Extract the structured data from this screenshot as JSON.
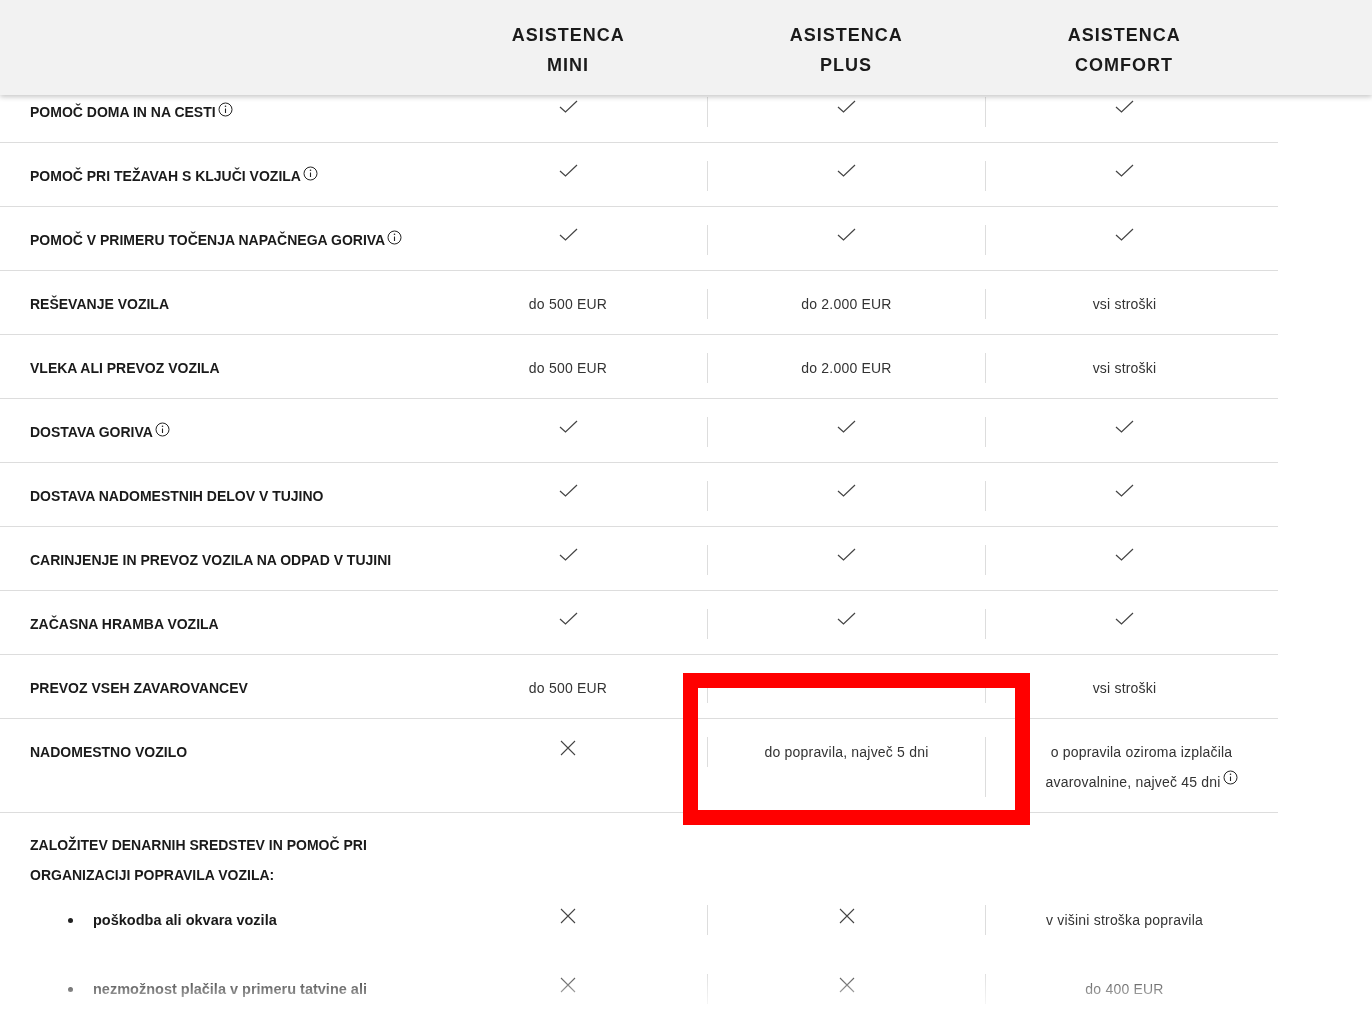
{
  "columns": [
    "ASISTENCA MINI",
    "ASISTENCA PLUS",
    "ASISTENCA COMFORT"
  ],
  "rows": [
    {
      "kind": "feature",
      "label": "POMOČ DOMA IN NA CESTI",
      "info": true,
      "cells": [
        {
          "kind": "check"
        },
        {
          "kind": "check"
        },
        {
          "kind": "check"
        }
      ]
    },
    {
      "kind": "feature",
      "label": "POMOČ PRI TEŽAVAH S KLJUČI VOZILA",
      "info": true,
      "cells": [
        {
          "kind": "check"
        },
        {
          "kind": "check"
        },
        {
          "kind": "check"
        }
      ]
    },
    {
      "kind": "feature",
      "label": "POMOČ V PRIMERU TOČENJA NAPAČNEGA GORIVA",
      "info": true,
      "cells": [
        {
          "kind": "check"
        },
        {
          "kind": "check"
        },
        {
          "kind": "check"
        }
      ]
    },
    {
      "kind": "feature",
      "label": "REŠEVANJE VOZILA",
      "info": false,
      "cells": [
        {
          "kind": "text",
          "lines": [
            "do 500 EUR"
          ]
        },
        {
          "kind": "text",
          "lines": [
            "do 2.000 EUR"
          ]
        },
        {
          "kind": "text",
          "lines": [
            "vsi stroški"
          ]
        }
      ]
    },
    {
      "kind": "feature",
      "label": "VLEKA ALI PREVOZ VOZILA",
      "info": false,
      "cells": [
        {
          "kind": "text",
          "lines": [
            "do 500 EUR"
          ]
        },
        {
          "kind": "text",
          "lines": [
            "do 2.000 EUR"
          ]
        },
        {
          "kind": "text",
          "lines": [
            "vsi stroški"
          ]
        }
      ]
    },
    {
      "kind": "feature",
      "label": "DOSTAVA GORIVA",
      "info": true,
      "cells": [
        {
          "kind": "check"
        },
        {
          "kind": "check"
        },
        {
          "kind": "check"
        }
      ]
    },
    {
      "kind": "feature",
      "label": "DOSTAVA NADOMESTNIH DELOV V TUJINO",
      "info": false,
      "cells": [
        {
          "kind": "check"
        },
        {
          "kind": "check"
        },
        {
          "kind": "check"
        }
      ]
    },
    {
      "kind": "feature",
      "label": "CARINJENJE IN PREVOZ VOZILA NA ODPAD V TUJINI",
      "info": false,
      "cells": [
        {
          "kind": "check"
        },
        {
          "kind": "check"
        },
        {
          "kind": "check"
        }
      ]
    },
    {
      "kind": "feature",
      "label": "ZAČASNA HRAMBA VOZILA",
      "info": false,
      "cells": [
        {
          "kind": "check"
        },
        {
          "kind": "check"
        },
        {
          "kind": "check"
        }
      ]
    },
    {
      "kind": "feature",
      "label": "PREVOZ VSEH ZAVAROVANCEV",
      "info": false,
      "cells": [
        {
          "kind": "text",
          "lines": [
            "do 500 EUR"
          ]
        },
        {
          "kind": "blank"
        },
        {
          "kind": "text",
          "lines": [
            "vsi stroški"
          ]
        }
      ]
    },
    {
      "kind": "feature",
      "label": "NADOMESTNO VOZILO",
      "info": false,
      "cells": [
        {
          "kind": "cross"
        },
        {
          "kind": "text",
          "lines": [
            "do popravila, največ 5 dni"
          ]
        },
        {
          "kind": "text",
          "lines": [
            "o popravila oziroma izplačila",
            "avarovalnine, največ 45 dni"
          ],
          "info": true
        }
      ]
    },
    {
      "kind": "group",
      "label": "ZALOŽITEV DENARNIH SREDSTEV IN POMOČ PRI ORGANIZACIJI POPRAVILA VOZILA:"
    },
    {
      "kind": "bullet",
      "label": "poškodba ali okvara vozila",
      "cells": [
        {
          "kind": "cross"
        },
        {
          "kind": "cross"
        },
        {
          "kind": "text",
          "lines": [
            "v višini stroška popravila"
          ]
        }
      ]
    },
    {
      "kind": "bullet",
      "label": "nezmožnost plačila v primeru tatvine ali",
      "cells": [
        {
          "kind": "cross"
        },
        {
          "kind": "cross"
        },
        {
          "kind": "text",
          "lines": [
            "do 400 EUR"
          ]
        }
      ]
    }
  ]
}
